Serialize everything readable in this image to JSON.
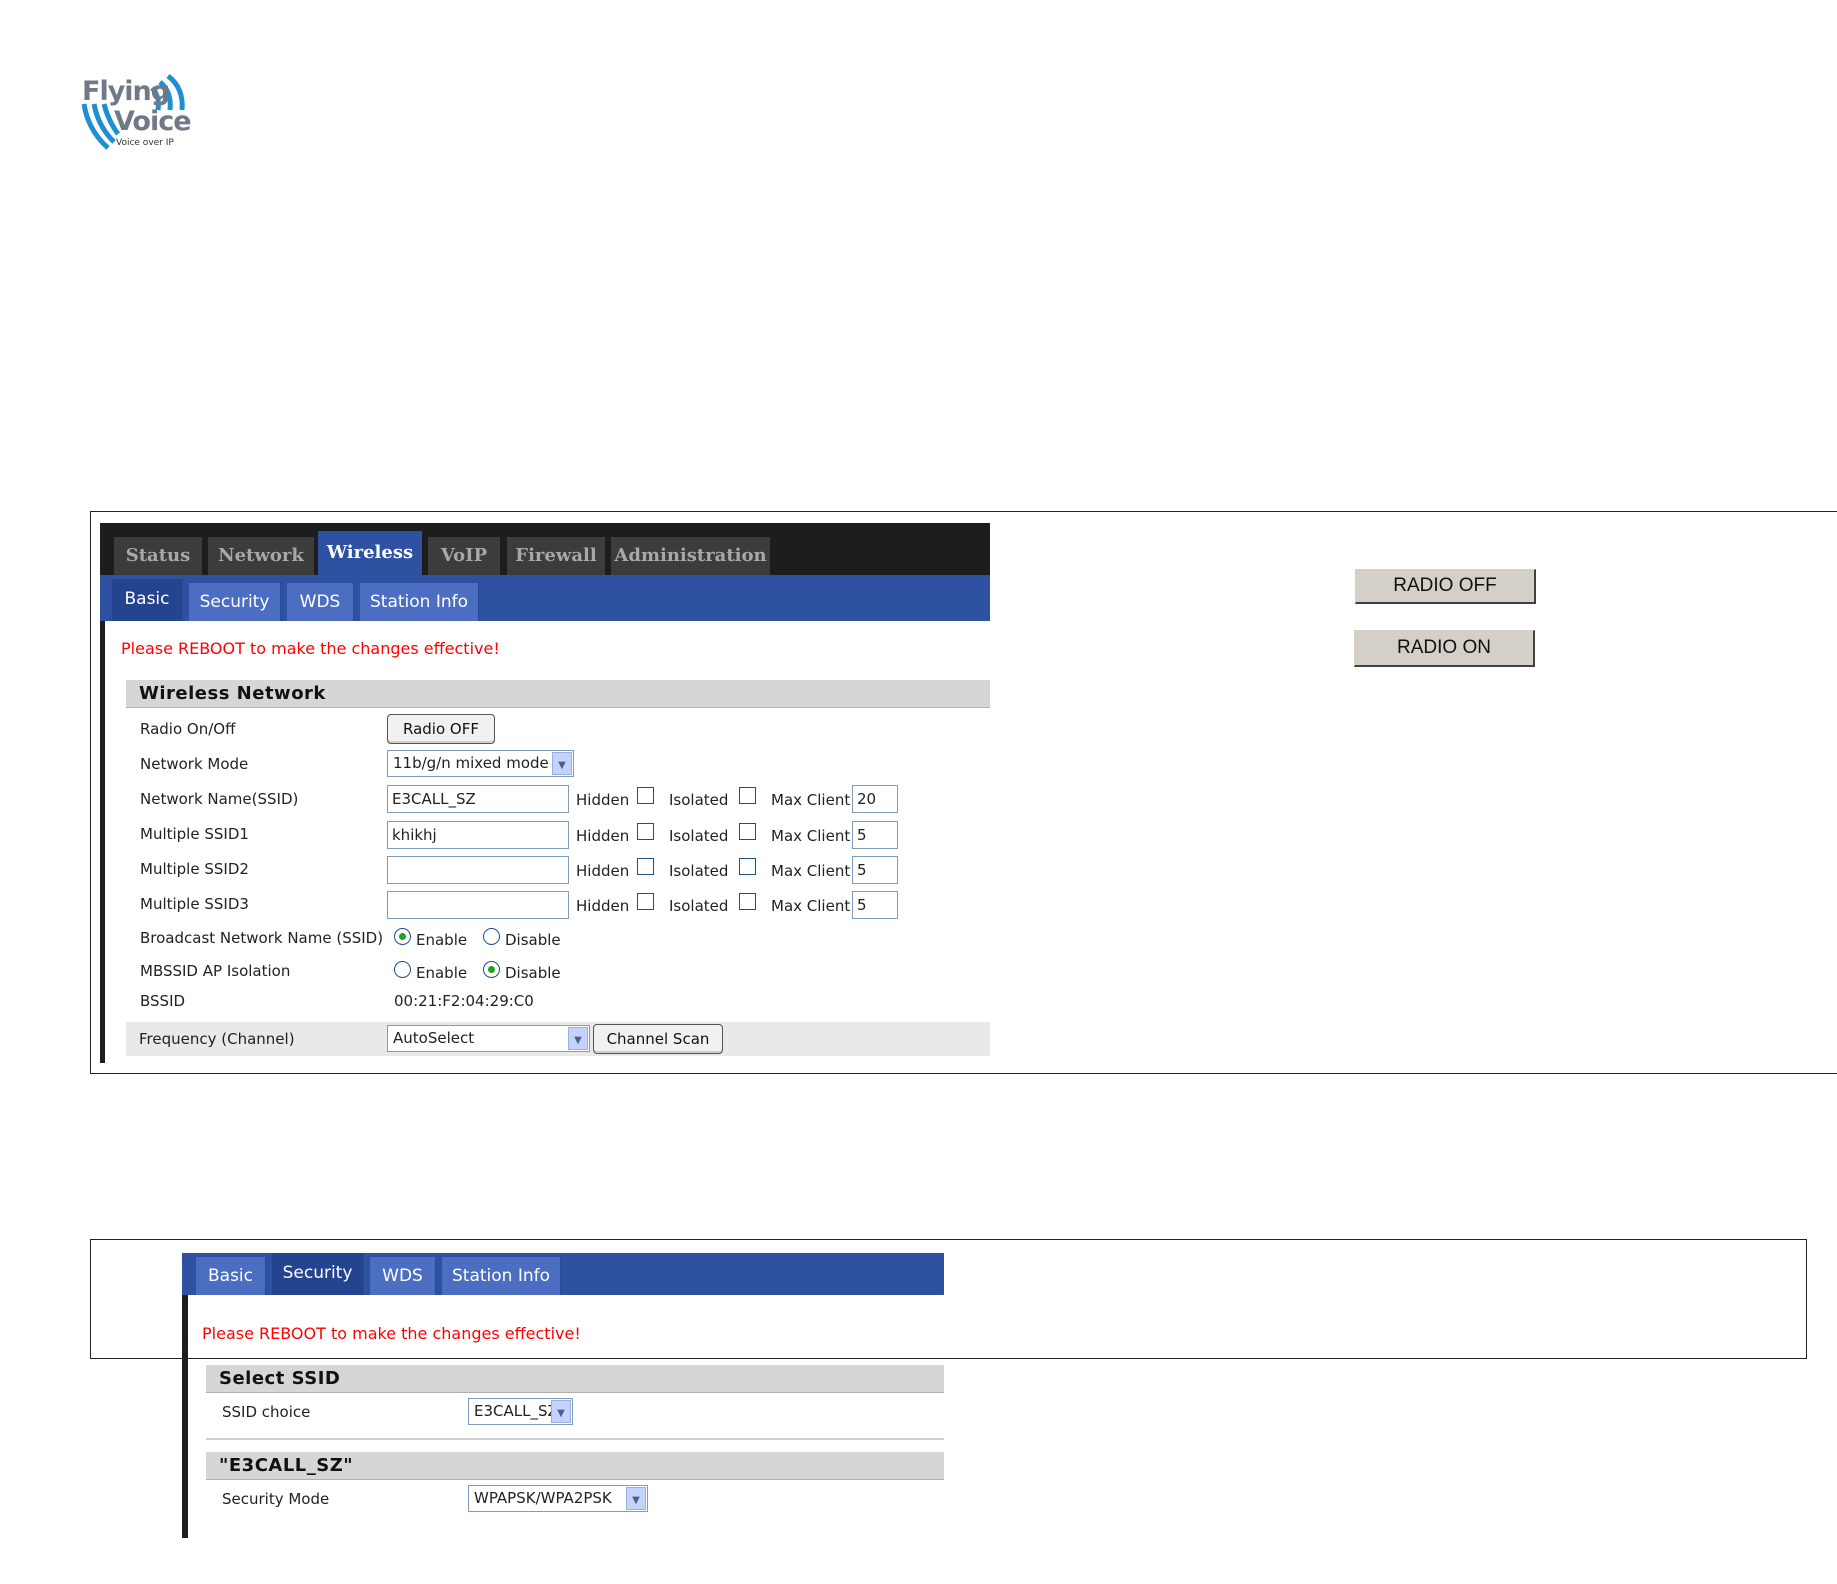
{
  "logo": {
    "line1": "Flying",
    "line2": "Voice",
    "tagline": "Voice over IP"
  },
  "main_tabs": [
    {
      "label": "Status"
    },
    {
      "label": "Network"
    },
    {
      "label": "Wireless",
      "active": true
    },
    {
      "label": "VoIP"
    },
    {
      "label": "Firewall"
    },
    {
      "label": "Administration"
    }
  ],
  "sub_tabs": [
    {
      "label": "Basic"
    },
    {
      "label": "Security"
    },
    {
      "label": "WDS"
    },
    {
      "label": "Station Info"
    }
  ],
  "panel1": {
    "notice": "Please REBOOT to make the changes effective!",
    "section_title": "Wireless Network",
    "radio": {
      "label": "Radio On/Off",
      "button": "Radio OFF"
    },
    "network_mode": {
      "label": "Network Mode",
      "value": "11b/g/n mixed mode"
    },
    "ssids": [
      {
        "label": "Network Name(SSID)",
        "value": "E3CALL_SZ",
        "max": "20"
      },
      {
        "label": "Multiple SSID1",
        "value": "khikhj",
        "max": "5"
      },
      {
        "label": "Multiple SSID2",
        "value": "",
        "max": "5"
      },
      {
        "label": "Multiple SSID3",
        "value": "",
        "max": "5"
      }
    ],
    "ssid_opts": {
      "hidden": "Hidden",
      "isolated": "Isolated",
      "max_client": "Max Client"
    },
    "broadcast": {
      "label": "Broadcast Network Name (SSID)",
      "enable": "Enable",
      "disable": "Disable",
      "selected": "Enable"
    },
    "mbssid": {
      "label": "MBSSID AP Isolation",
      "enable": "Enable",
      "disable": "Disable",
      "selected": "Disable"
    },
    "bssid": {
      "label": "BSSID",
      "value": "00:21:F2:04:29:C0"
    },
    "frequency": {
      "label": "Frequency (Channel)",
      "value": "AutoSelect",
      "scan_button": "Channel Scan"
    }
  },
  "side_buttons": {
    "radio_off": "RADIO OFF",
    "radio_on": "RADIO ON"
  },
  "panel2": {
    "active_tab": "Security",
    "notice": "Please REBOOT to make the changes effective!",
    "select_section": "Select SSID",
    "ssid_choice": {
      "label": "SSID choice",
      "value": "E3CALL_SZ"
    },
    "ssid_section": "\"E3CALL_SZ\"",
    "security_mode": {
      "label": "Security Mode",
      "value": "WPAPSK/WPA2PSK"
    }
  },
  "colors": {
    "tab_blue": "#2f51a2",
    "notice_red": "#ff0000",
    "dark_bar": "#1d1d1d"
  }
}
